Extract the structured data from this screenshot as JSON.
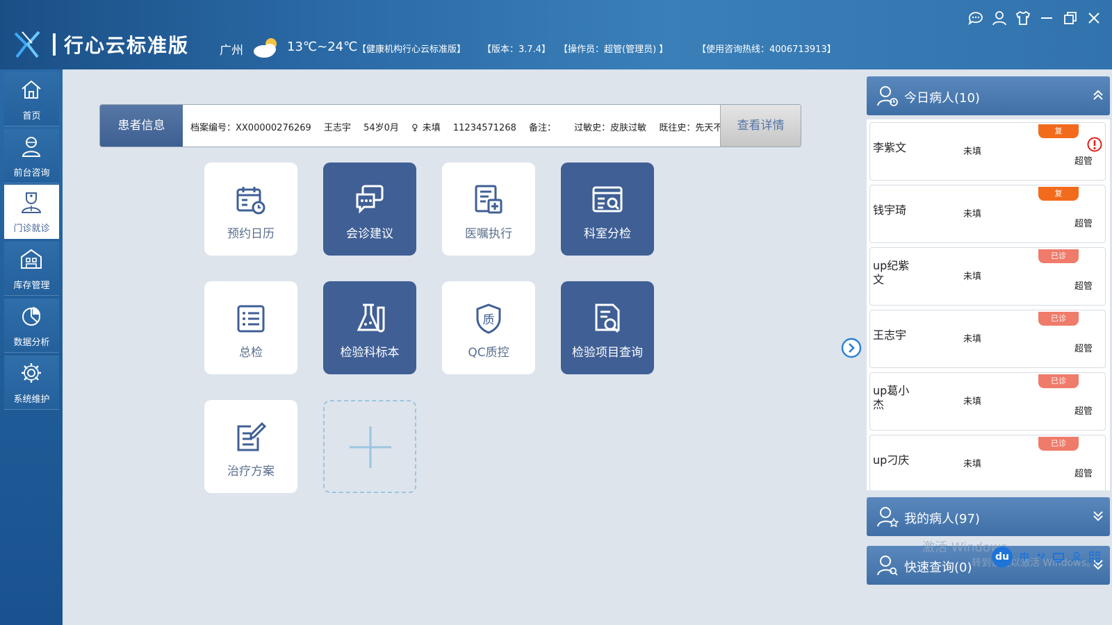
{
  "header": {
    "app_title": "行心云标准版",
    "city": "广州",
    "temperature": "13℃~24℃",
    "institution": "【健康机构行心云标准版】",
    "version": "【版本：3.7.4】",
    "operator": "【操作员：超管(管理员) 】",
    "hotline": "【使用咨询热线：4006713913】",
    "icons": [
      "chat-icon",
      "user-icon",
      "skin-icon",
      "minimize-icon",
      "restore-icon",
      "close-icon"
    ]
  },
  "nav": {
    "items": [
      {
        "label": "首页",
        "icon": "home-icon"
      },
      {
        "label": "前台咨询",
        "icon": "consultant-icon"
      },
      {
        "label": "门诊就诊",
        "icon": "doctor-icon",
        "active": true
      },
      {
        "label": "库存管理",
        "icon": "warehouse-icon"
      },
      {
        "label": "数据分析",
        "icon": "chart-icon"
      },
      {
        "label": "系统维护",
        "icon": "settings-icon"
      }
    ]
  },
  "patient": {
    "label": "患者信息",
    "file_no": "档案编号：XX00000276269",
    "name": "王志宇",
    "age": "54岁0月",
    "gender": "未填",
    "phone": "11234571268",
    "remark": "备注：",
    "allergy": "过敏史：皮肤过敏",
    "history": "既往史：先天不足",
    "detail_button": "查看详情"
  },
  "tiles": [
    {
      "label": "预约日历",
      "icon": "calendar-icon",
      "dark": false
    },
    {
      "label": "会诊建议",
      "icon": "consult-chat-icon",
      "dark": true
    },
    {
      "label": "医嘱执行",
      "icon": "order-icon",
      "dark": false
    },
    {
      "label": "科室分检",
      "icon": "department-search-icon",
      "dark": true
    },
    {
      "label": "总检",
      "icon": "list-icon",
      "dark": false
    },
    {
      "label": "检验科标本",
      "icon": "flask-icon",
      "dark": true
    },
    {
      "label": "QC质控",
      "icon": "qc-shield-icon",
      "dark": false
    },
    {
      "label": "检验项目查询",
      "icon": "doc-search-icon",
      "dark": true
    },
    {
      "label": "治疗方案",
      "icon": "edit-icon",
      "dark": false
    }
  ],
  "right_panel": {
    "today_title": "今日病人(10)",
    "my_title": "我的病人(97)",
    "quick_title": "快速查询(0)",
    "patients": [
      {
        "name": "李紫文",
        "status": "未填",
        "doctor": "超管",
        "badge": "复",
        "badge_type": "fu",
        "alert": true
      },
      {
        "name": "钱宇琦",
        "status": "未填",
        "doctor": "超管",
        "badge": "复",
        "badge_type": "fu",
        "alert": false
      },
      {
        "name": "up纪紫文",
        "status": "未填",
        "doctor": "超管",
        "badge": "已诊",
        "badge_type": "yz",
        "alert": false
      },
      {
        "name": "王志宇",
        "status": "未填",
        "doctor": "超管",
        "badge": "已诊",
        "badge_type": "yz",
        "alert": false
      },
      {
        "name": "up葛小杰",
        "status": "未填",
        "doctor": "超管",
        "badge": "已诊",
        "badge_type": "yz",
        "alert": false
      },
      {
        "name": "up刁庆",
        "status": "未填",
        "doctor": "超管",
        "badge": "已诊",
        "badge_type": "yz",
        "alert": false
      }
    ]
  },
  "overlay": {
    "watermark_line1": "激活 Windows",
    "watermark_line2": "转到设置以激活 Windows。",
    "ime_logo": "du",
    "ime_mode": "中"
  }
}
